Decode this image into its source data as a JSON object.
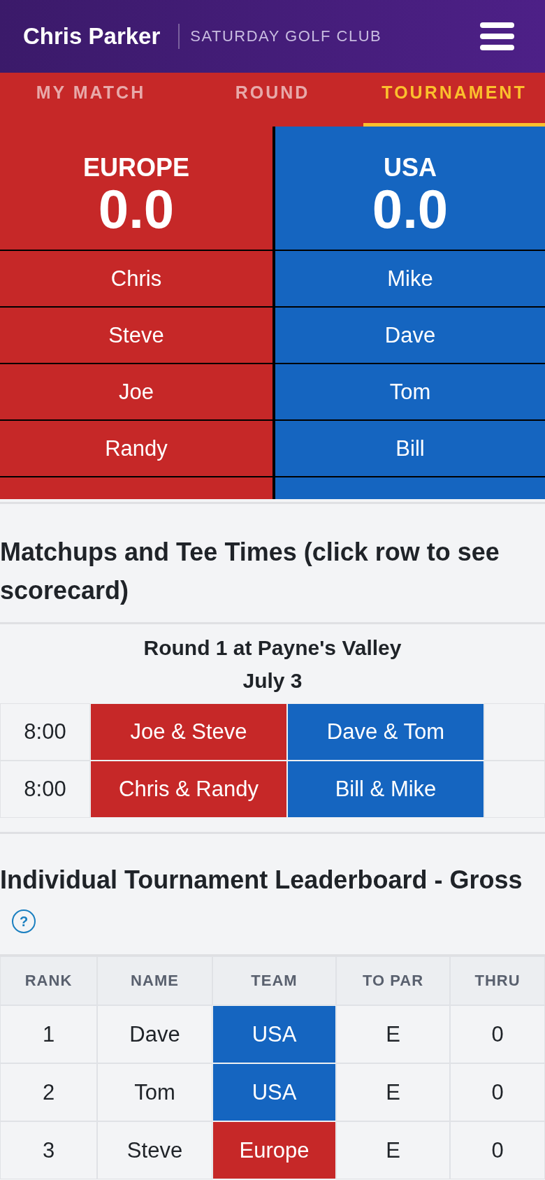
{
  "header": {
    "user_name": "Chris Parker",
    "club_name": "SATURDAY GOLF CLUB"
  },
  "tabs": [
    {
      "label": "MY MATCH",
      "selected": false
    },
    {
      "label": "ROUND",
      "selected": false
    },
    {
      "label": "TOURNAMENT",
      "selected": true
    }
  ],
  "teams": [
    {
      "name": "EUROPE",
      "score": "0.0",
      "color": "#c62828",
      "players": [
        "Chris",
        "Steve",
        "Joe",
        "Randy"
      ]
    },
    {
      "name": "USA",
      "score": "0.0",
      "color": "#1565c0",
      "players": [
        "Mike",
        "Dave",
        "Tom",
        "Bill"
      ]
    }
  ],
  "matchups": {
    "title": "Matchups and Tee Times (click row to see scorecard)",
    "round_title": "Round 1 at Payne's Valley",
    "date": "July 3",
    "rows": [
      {
        "time": "8:00",
        "sides": [
          {
            "players": "Joe & Steve",
            "color": "#c62828"
          },
          {
            "players": "Dave & Tom",
            "color": "#1565c0"
          }
        ]
      },
      {
        "time": "8:00",
        "sides": [
          {
            "players": "Chris & Randy",
            "color": "#c62828"
          },
          {
            "players": "Bill & Mike",
            "color": "#1565c0"
          }
        ]
      }
    ]
  },
  "leaderboard": {
    "title": "Individual Tournament Leaderboard - Gross",
    "help_icon": "?",
    "columns": [
      "RANK",
      "NAME",
      "TEAM",
      "TO PAR",
      "THRU"
    ],
    "rows": [
      {
        "rank": "1",
        "name": "Dave",
        "team": "USA",
        "color": "#1565c0",
        "to_par": "E",
        "thru": "0"
      },
      {
        "rank": "2",
        "name": "Tom",
        "team": "USA",
        "color": "#1565c0",
        "to_par": "E",
        "thru": "0"
      },
      {
        "rank": "3",
        "name": "Steve",
        "team": "Europe",
        "color": "#c62828",
        "to_par": "E",
        "thru": "0"
      }
    ]
  }
}
